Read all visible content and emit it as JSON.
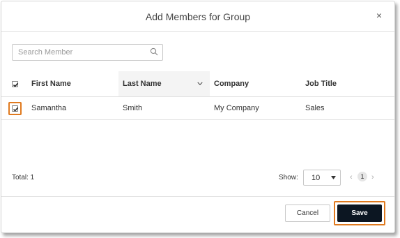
{
  "dialog": {
    "title": "Add Members for Group",
    "close_label": "×"
  },
  "search": {
    "placeholder": "Search Member",
    "icon": "search-icon"
  },
  "table": {
    "columns": [
      "First Name",
      "Last Name",
      "Company",
      "Job Title"
    ],
    "sorted_column": "Last Name",
    "sort_icon": "chevron-down-icon",
    "header_checkbox_checked": true,
    "rows": [
      {
        "checked": true,
        "first_name": "Samantha",
        "last_name": "Smith",
        "company": "My Company",
        "job_title": "Sales"
      }
    ]
  },
  "footer": {
    "total_label": "Total: 1",
    "show_label": "Show:",
    "page_size": "10",
    "prev_label": "‹",
    "current_page": "1",
    "next_label": "›"
  },
  "actions": {
    "cancel_label": "Cancel",
    "save_label": "Save"
  },
  "colors": {
    "accent_highlight": "#e07a1f",
    "save_button": "#0c1622",
    "sorted_column_bg": "#f4f4f4"
  }
}
